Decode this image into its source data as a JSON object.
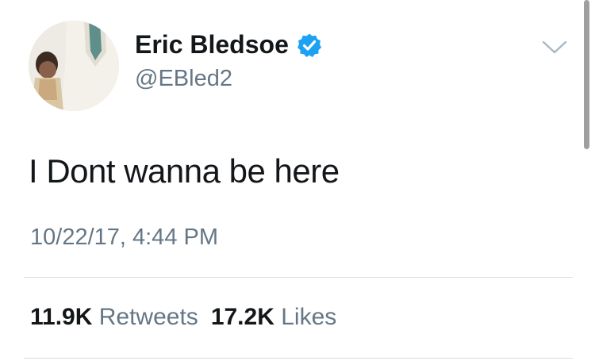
{
  "tweet": {
    "author": {
      "display_name": "Eric Bledsoe",
      "handle": "@EBled2",
      "verified": true
    },
    "text": "I Dont wanna be here",
    "timestamp": "10/22/17, 4:44 PM",
    "stats": {
      "retweets_count": "11.9K",
      "retweets_label": "Retweets",
      "likes_count": "17.2K",
      "likes_label": "Likes"
    }
  },
  "colors": {
    "text_primary": "#14171a",
    "text_secondary": "#657786",
    "verified_blue": "#1da1f2",
    "divider": "#d8dee3"
  },
  "icons": {
    "verified": "verified-badge-icon",
    "menu": "chevron-down-icon"
  }
}
